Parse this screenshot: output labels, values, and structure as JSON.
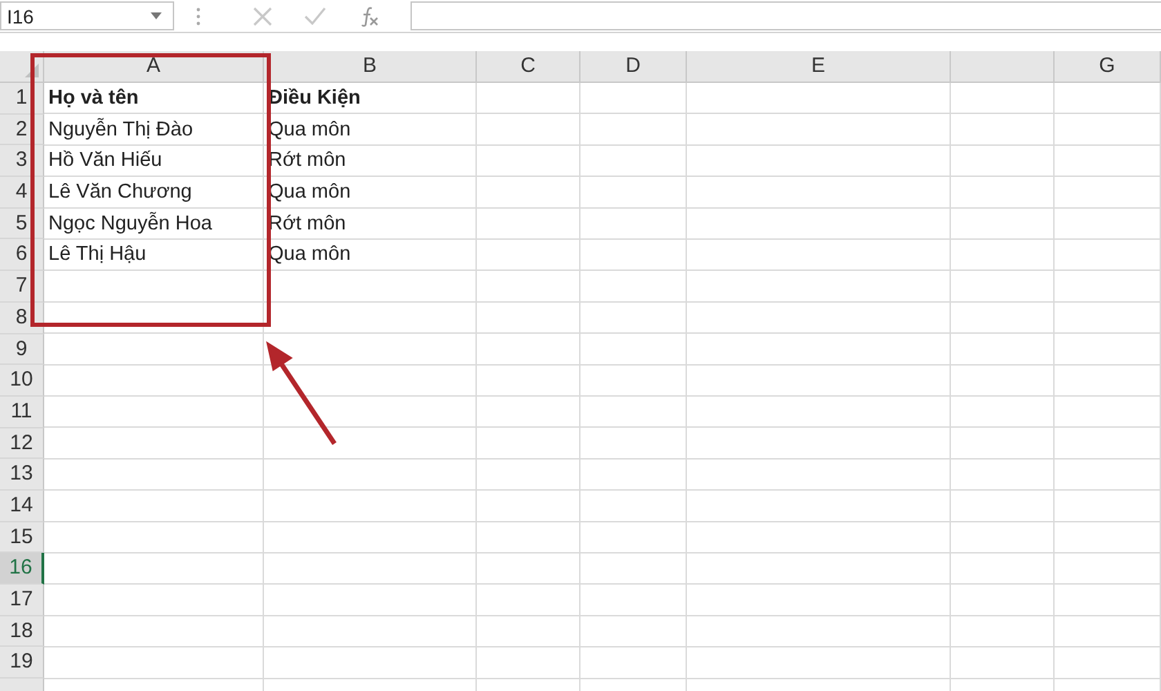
{
  "name_box": {
    "value": "I16"
  },
  "columns": [
    {
      "label": "A"
    },
    {
      "label": "B"
    },
    {
      "label": "C"
    },
    {
      "label": "D"
    },
    {
      "label": "E"
    },
    {},
    {
      "label": "G"
    }
  ],
  "rows": [
    {
      "number": "1",
      "selected": false,
      "kind": "header",
      "cells": [
        "Họ và tên",
        "Điều Kiện"
      ]
    },
    {
      "number": "2",
      "selected": false,
      "kind": "data",
      "cells": [
        "Nguyễn Thị Đào",
        "Qua môn"
      ]
    },
    {
      "number": "3",
      "selected": false,
      "kind": "data",
      "cells": [
        "Hồ Văn Hiếu",
        "Rớt môn"
      ]
    },
    {
      "number": "4",
      "selected": false,
      "kind": "data",
      "cells": [
        "Lê Văn Chương",
        "Qua môn"
      ]
    },
    {
      "number": "5",
      "selected": false,
      "kind": "data",
      "cells": [
        "Ngọc Nguyễn Hoa",
        "Rớt môn"
      ]
    },
    {
      "number": "6",
      "selected": false,
      "kind": "data",
      "cells": [
        "Lê Thị Hậu",
        "Qua môn"
      ]
    },
    {
      "number": "7",
      "selected": false
    },
    {
      "number": "8",
      "selected": false
    },
    {
      "number": "9",
      "selected": false
    },
    {
      "number": "10",
      "selected": false
    },
    {
      "number": "11",
      "selected": false
    },
    {
      "number": "12",
      "selected": false
    },
    {
      "number": "13",
      "selected": false
    },
    {
      "number": "14",
      "selected": false
    },
    {
      "number": "15",
      "selected": false
    },
    {
      "number": "16",
      "selected": true
    },
    {
      "number": "17",
      "selected": false
    },
    {
      "number": "18",
      "selected": false
    },
    {
      "number": "19",
      "selected": false
    }
  ]
}
